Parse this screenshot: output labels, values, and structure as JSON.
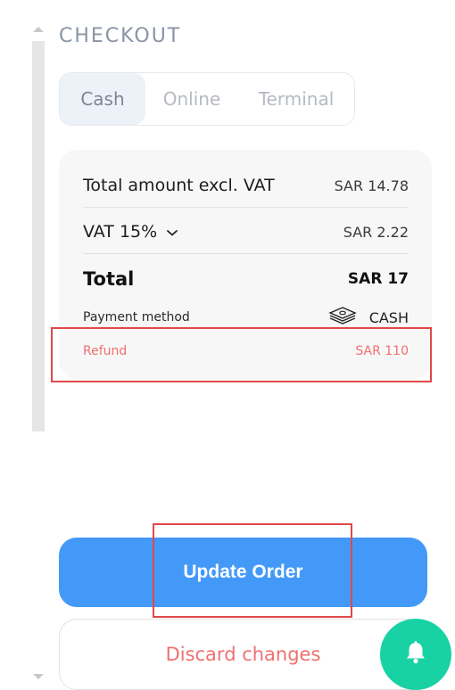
{
  "header": {
    "title": "CHECKOUT"
  },
  "payment_tabs": [
    {
      "label": "Cash",
      "selected": true
    },
    {
      "label": "Online",
      "selected": false
    },
    {
      "label": "Terminal",
      "selected": false
    }
  ],
  "summary": {
    "subtotal_label": "Total amount excl. VAT",
    "subtotal_value": "SAR 14.78",
    "vat_label": "VAT 15%",
    "vat_value": "SAR 2.22",
    "total_label": "Total",
    "total_value": "SAR 17",
    "payment_method_label": "Payment method",
    "payment_method_value": "CASH",
    "payment_method_icon": "cash-stack-icon",
    "refund_label": "Refund",
    "refund_value": "SAR 110"
  },
  "actions": {
    "update_label": "Update Order",
    "discard_label": "Discard changes"
  },
  "colors": {
    "primary": "#4399f7",
    "danger": "#f07070",
    "fab": "#18d2a4",
    "highlight": "#e04848"
  }
}
